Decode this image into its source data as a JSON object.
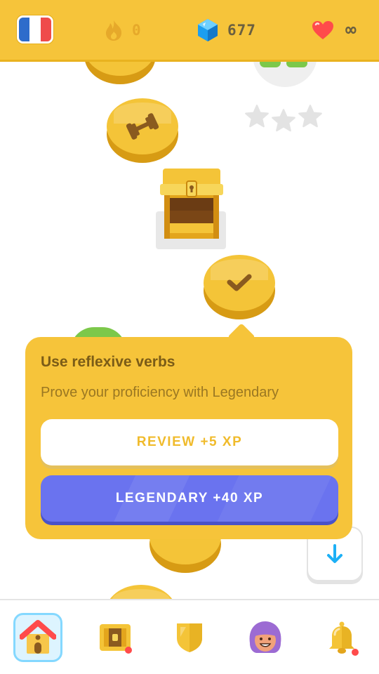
{
  "topbar": {
    "language_flag": "french-flag",
    "streak": {
      "icon": "flame-icon",
      "count": "0"
    },
    "gems": {
      "icon": "gem-icon",
      "count": "677"
    },
    "hearts": {
      "icon": "heart-icon",
      "count": "∞"
    }
  },
  "path": {
    "nodes": [
      {
        "type": "practice",
        "icon": "dumbbell-icon"
      },
      {
        "type": "chest",
        "icon": "treasure-chest-icon"
      },
      {
        "type": "completed",
        "icon": "checkmark-icon"
      },
      {
        "type": "story",
        "icon": "book-icon"
      }
    ],
    "stars_earned": 0,
    "stars_total": 3
  },
  "popup": {
    "title": "Use reflexive verbs",
    "subtitle": "Prove your proficiency with Legendary",
    "review_label": "REVIEW +5 XP",
    "legendary_label": "LEGENDARY +40 XP"
  },
  "scroll_button": {
    "icon": "arrow-down-icon"
  },
  "nav": {
    "items": [
      {
        "name": "home",
        "icon": "house-icon",
        "selected": true
      },
      {
        "name": "characters",
        "icon": "treasure-chest-icon"
      },
      {
        "name": "leagues",
        "icon": "shield-icon"
      },
      {
        "name": "profile",
        "icon": "avatar-icon"
      },
      {
        "name": "notifications",
        "icon": "bell-icon"
      }
    ]
  },
  "colors": {
    "topbar": "#f6c43a",
    "legendary_button": "#6a73ef",
    "review_text": "#f0bb2c",
    "popup_title": "#7b5c17",
    "notification_dot": "#ff4b4b"
  }
}
